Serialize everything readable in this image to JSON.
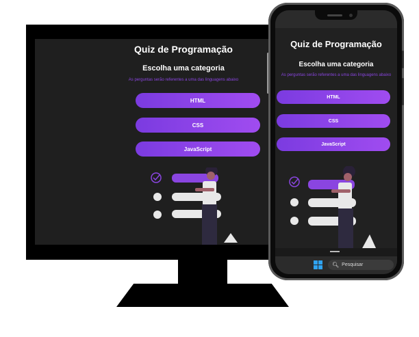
{
  "app": {
    "title": "Quiz de Programação",
    "subtitle": "Escolha uma categoria",
    "description": "As perguntas serão referentes a uma das linguagens abaixo",
    "categories": [
      "HTML",
      "CSS",
      "JavaScript"
    ]
  },
  "taskbar": {
    "search_label": "Pesquisar"
  },
  "colors": {
    "accent": "#8a45e0",
    "button_start": "#7b3be0",
    "button_end": "#a04cf0",
    "background": "#1f1f1f",
    "illustration_shirt": "#e8e8e8",
    "illustration_pants": "#2e2a3f",
    "illustration_skin": "#a0616a"
  },
  "icons": [
    "check-circle-icon",
    "windows-logo-icon",
    "search-icon"
  ]
}
